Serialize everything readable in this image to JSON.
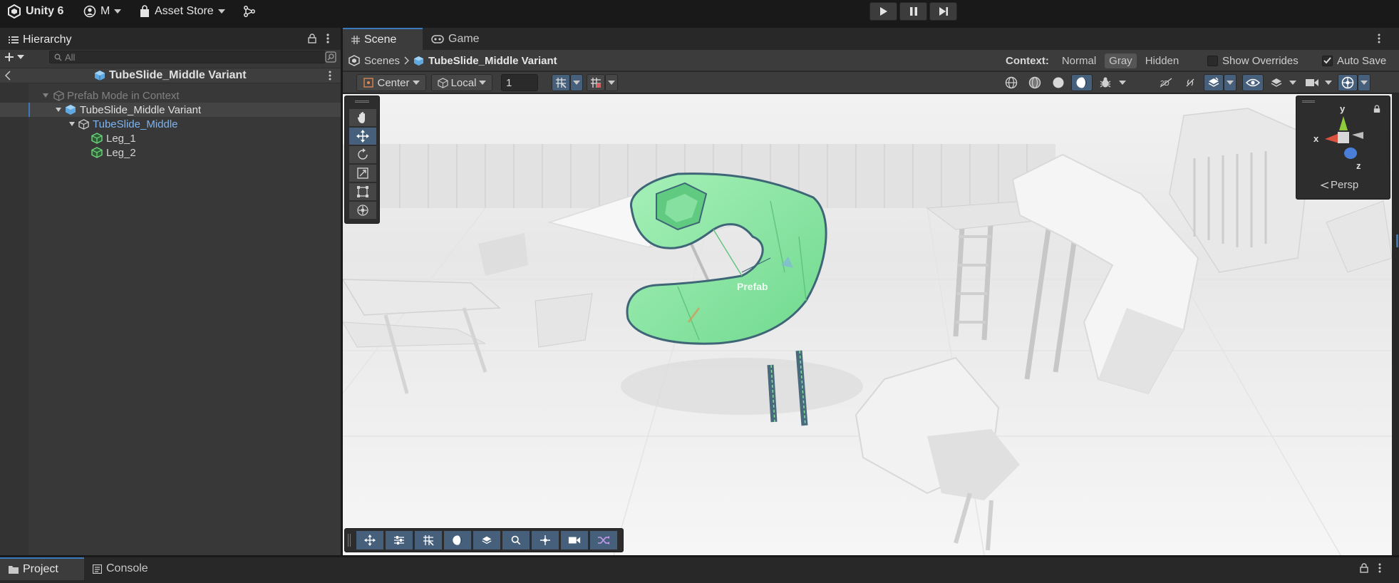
{
  "topbar": {
    "unity_label": "Unity 6",
    "account_label": "M",
    "asset_store_label": "Asset Store"
  },
  "hierarchy": {
    "tab_label": "Hierarchy",
    "search_placeholder": "All",
    "header_title": "TubeSlide_Middle Variant",
    "items": [
      {
        "label": "Prefab Mode in Context",
        "icon": "prefab-icon"
      },
      {
        "label": "TubeSlide_Middle Variant",
        "icon": "prefab-variant-icon"
      },
      {
        "label": "TubeSlide_Middle",
        "icon": "prefab-icon"
      },
      {
        "label": "Leg_1",
        "icon": "mesh-object-icon"
      },
      {
        "label": "Leg_2",
        "icon": "mesh-object-icon"
      }
    ]
  },
  "scene": {
    "tabs": [
      {
        "label": "Scene"
      },
      {
        "label": "Game"
      }
    ],
    "breadcrumb": {
      "root": "Scenes",
      "current": "TubeSlide_Middle Variant"
    },
    "context": {
      "label": "Context:",
      "options": [
        "Normal",
        "Gray",
        "Hidden"
      ],
      "selected": "Gray"
    },
    "show_overrides_label": "Show Overrides",
    "auto_save_label": "Auto Save",
    "pivot_mode": "Center",
    "pivot_rotation": "Local",
    "grid_increment": "1",
    "gizmo": {
      "x": "x",
      "y": "y",
      "z": "z",
      "projection": "Persp"
    },
    "prefab_label": "Prefab",
    "accent_color": "#3a79bb",
    "selection_color": "#8de8a8"
  },
  "bottom": {
    "tabs": [
      {
        "label": "Project"
      },
      {
        "label": "Console"
      }
    ]
  }
}
